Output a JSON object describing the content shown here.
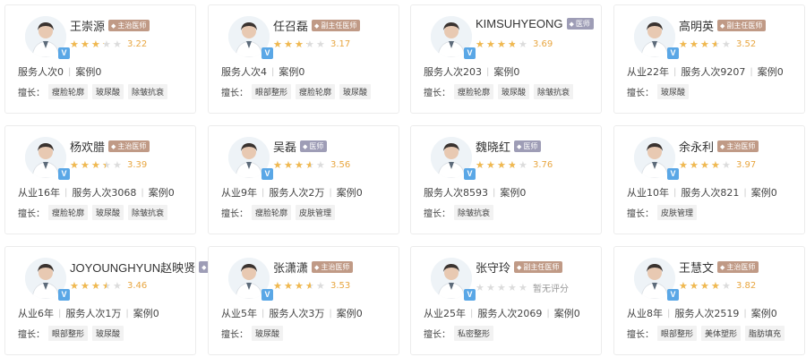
{
  "skills_label": "擅长：",
  "sep": "|",
  "cards": [
    {
      "name": "王崇源",
      "title": "主治医师",
      "title_color": "brown",
      "rating": 3.22,
      "score": "3.22",
      "stats": [
        "服务人次0",
        "案例0"
      ],
      "skills": [
        "瘦脸轮廓",
        "玻尿酸",
        "除皱抗衰"
      ]
    },
    {
      "name": "任召磊",
      "title": "副主任医师",
      "title_color": "brown",
      "rating": 3.17,
      "score": "3.17",
      "stats": [
        "服务人次4",
        "案例0"
      ],
      "skills": [
        "眼部整形",
        "瘦脸轮廓",
        "玻尿酸"
      ]
    },
    {
      "name": "KIMSUHYEONG",
      "title": "医师",
      "title_color": "purple",
      "rating": 3.69,
      "score": "3.69",
      "stats": [
        "服务人次203",
        "案例0"
      ],
      "skills": [
        "瘦脸轮廓",
        "玻尿酸",
        "除皱抗衰"
      ]
    },
    {
      "name": "高明英",
      "title": "副主任医师",
      "title_color": "brown",
      "rating": 3.52,
      "score": "3.52",
      "stats": [
        "从业22年",
        "服务人次9207",
        "案例0"
      ],
      "skills": [
        "玻尿酸"
      ]
    },
    {
      "name": "杨欢腊",
      "title": "主治医师",
      "title_color": "brown",
      "rating": 3.39,
      "score": "3.39",
      "stats": [
        "从业16年",
        "服务人次3068",
        "案例0"
      ],
      "skills": [
        "瘦脸轮廓",
        "玻尿酸",
        "除皱抗衰"
      ]
    },
    {
      "name": "吴磊",
      "title": "医师",
      "title_color": "purple",
      "rating": 3.56,
      "score": "3.56",
      "stats": [
        "从业9年",
        "服务人次2万",
        "案例0"
      ],
      "skills": [
        "瘦脸轮廓",
        "皮肤管理"
      ]
    },
    {
      "name": "魏晓红",
      "title": "医师",
      "title_color": "purple",
      "rating": 3.76,
      "score": "3.76",
      "stats": [
        "服务人次8593",
        "案例0"
      ],
      "skills": [
        "除皱抗衰"
      ]
    },
    {
      "name": "余永利",
      "title": "主治医师",
      "title_color": "brown",
      "rating": 3.97,
      "score": "3.97",
      "stats": [
        "从业10年",
        "服务人次821",
        "案例0"
      ],
      "skills": [
        "皮肤管理"
      ]
    },
    {
      "name": "JOYOUNGHYUN赵映贤",
      "title": "医",
      "title_color": "purple",
      "rating": 3.46,
      "score": "3.46",
      "stats": [
        "从业6年",
        "服务人次1万",
        "案例0"
      ],
      "skills": [
        "眼部整形",
        "玻尿酸"
      ]
    },
    {
      "name": "张潇潇",
      "title": "主治医师",
      "title_color": "brown",
      "rating": 3.53,
      "score": "3.53",
      "stats": [
        "从业5年",
        "服务人次3万",
        "案例0"
      ],
      "skills": [
        "玻尿酸"
      ]
    },
    {
      "name": "张守玲",
      "title": "副主任医师",
      "title_color": "brown",
      "rating": 0,
      "score": "暂无评分",
      "stats": [
        "从业25年",
        "服务人次2069",
        "案例0"
      ],
      "skills": [
        "私密整形"
      ]
    },
    {
      "name": "王慧文",
      "title": "主治医师",
      "title_color": "brown",
      "rating": 3.82,
      "score": "3.82",
      "stats": [
        "从业8年",
        "服务人次2519",
        "案例0"
      ],
      "skills": [
        "眼部整形",
        "美体塑形",
        "脂肪填充"
      ]
    }
  ],
  "colors": {
    "star": "#f1b94f",
    "score": "#e8a640",
    "badge_brown": "#c09a86",
    "badge_purple": "#9e9db6",
    "verified": "#5aa7e6"
  },
  "icons": {
    "verified": "v-verified-icon",
    "star": "star-icon"
  },
  "verified_label": "V"
}
